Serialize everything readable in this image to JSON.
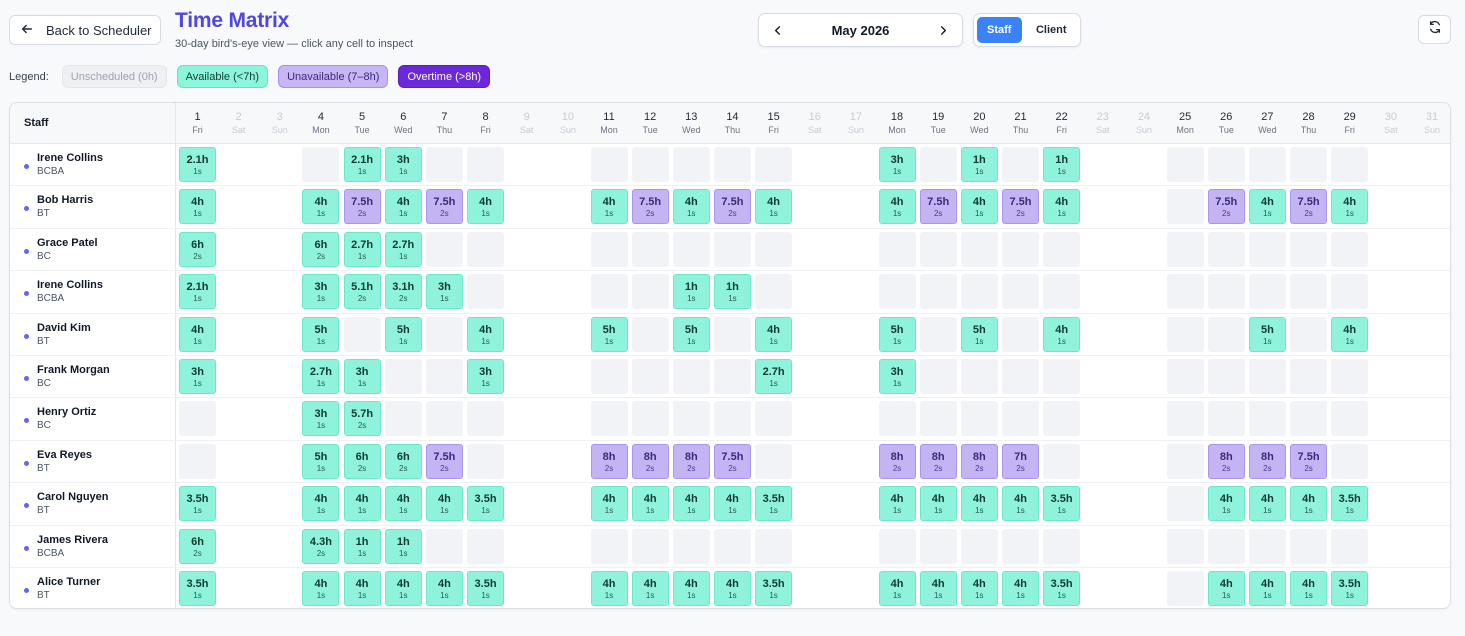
{
  "header": {
    "back_label": "Back to Scheduler",
    "title": "Time Matrix",
    "subtitle": "30-day bird's-eye view — click any cell to inspect",
    "month_label": "May 2026",
    "view_toggle": {
      "staff": "Staff",
      "client": "Client",
      "active": "Staff"
    }
  },
  "legend": {
    "label": "Legend:",
    "items": [
      {
        "key": "unsched",
        "label": "Unscheduled (0h)"
      },
      {
        "key": "avail",
        "label": "Available (<7h)"
      },
      {
        "key": "unavail",
        "label": "Unavailable (7–8h)"
      },
      {
        "key": "over",
        "label": "Overtime (>8h)"
      }
    ]
  },
  "colors": {
    "accent": "#4f46e5",
    "toggle_active": "#3b82f6",
    "available": "#8ef3da",
    "unavailable": "#c4b4f3",
    "overtime": "#6d28d9",
    "unscheduled": "#f1f3f7"
  },
  "table": {
    "staff_header": "Staff",
    "days": [
      {
        "d": "1",
        "w": "Fri"
      },
      {
        "d": "2",
        "w": "Sat",
        "we": true
      },
      {
        "d": "3",
        "w": "Sun",
        "we": true
      },
      {
        "d": "4",
        "w": "Mon"
      },
      {
        "d": "5",
        "w": "Tue"
      },
      {
        "d": "6",
        "w": "Wed"
      },
      {
        "d": "7",
        "w": "Thu"
      },
      {
        "d": "8",
        "w": "Fri"
      },
      {
        "d": "9",
        "w": "Sat",
        "we": true
      },
      {
        "d": "10",
        "w": "Sun",
        "we": true
      },
      {
        "d": "11",
        "w": "Mon"
      },
      {
        "d": "12",
        "w": "Tue"
      },
      {
        "d": "13",
        "w": "Wed"
      },
      {
        "d": "14",
        "w": "Thu"
      },
      {
        "d": "15",
        "w": "Fri"
      },
      {
        "d": "16",
        "w": "Sat",
        "we": true
      },
      {
        "d": "17",
        "w": "Sun",
        "we": true
      },
      {
        "d": "18",
        "w": "Mon"
      },
      {
        "d": "19",
        "w": "Tue"
      },
      {
        "d": "20",
        "w": "Wed"
      },
      {
        "d": "21",
        "w": "Thu"
      },
      {
        "d": "22",
        "w": "Fri"
      },
      {
        "d": "23",
        "w": "Sat",
        "we": true
      },
      {
        "d": "24",
        "w": "Sun",
        "we": true
      },
      {
        "d": "25",
        "w": "Mon"
      },
      {
        "d": "26",
        "w": "Tue"
      },
      {
        "d": "27",
        "w": "Wed"
      },
      {
        "d": "28",
        "w": "Thu"
      },
      {
        "d": "29",
        "w": "Fri"
      },
      {
        "d": "30",
        "w": "Sat",
        "we": true
      },
      {
        "d": "31",
        "w": "Sun",
        "we": true
      }
    ],
    "rows": [
      {
        "name": "Irene Collins",
        "role": "BCBA",
        "cells": [
          [
            "2.1h",
            "1s"
          ],
          null,
          null,
          "e",
          [
            "2.1h",
            "1s"
          ],
          [
            "3h",
            "1s"
          ],
          "e",
          "e",
          null,
          null,
          "e",
          "e",
          "e",
          "e",
          "e",
          null,
          null,
          [
            "3h",
            "1s"
          ],
          "e",
          [
            "1h",
            "1s"
          ],
          "e",
          [
            "1h",
            "1s"
          ],
          null,
          null,
          "e",
          "e",
          "e",
          "e",
          "e",
          null,
          null
        ]
      },
      {
        "name": "Bob Harris",
        "role": "BT",
        "cells": [
          [
            "4h",
            "1s"
          ],
          null,
          null,
          [
            "4h",
            "1s"
          ],
          [
            "7.5h",
            "2s"
          ],
          [
            "4h",
            "1s"
          ],
          [
            "7.5h",
            "2s"
          ],
          [
            "4h",
            "1s"
          ],
          null,
          null,
          [
            "4h",
            "1s"
          ],
          [
            "7.5h",
            "2s"
          ],
          [
            "4h",
            "1s"
          ],
          [
            "7.5h",
            "2s"
          ],
          [
            "4h",
            "1s"
          ],
          null,
          null,
          [
            "4h",
            "1s"
          ],
          [
            "7.5h",
            "2s"
          ],
          [
            "4h",
            "1s"
          ],
          [
            "7.5h",
            "2s"
          ],
          [
            "4h",
            "1s"
          ],
          null,
          null,
          "e",
          [
            "7.5h",
            "2s"
          ],
          [
            "4h",
            "1s"
          ],
          [
            "7.5h",
            "2s"
          ],
          [
            "4h",
            "1s"
          ],
          null,
          null
        ]
      },
      {
        "name": "Grace Patel",
        "role": "BC",
        "cells": [
          [
            "6h",
            "2s"
          ],
          null,
          null,
          [
            "6h",
            "2s"
          ],
          [
            "2.7h",
            "1s"
          ],
          [
            "2.7h",
            "1s"
          ],
          "e",
          "e",
          null,
          null,
          "e",
          "e",
          "e",
          "e",
          "e",
          null,
          null,
          "e",
          "e",
          "e",
          "e",
          "e",
          null,
          null,
          "e",
          "e",
          "e",
          "e",
          "e",
          null,
          null
        ]
      },
      {
        "name": "Irene Collins",
        "role": "BCBA",
        "cells": [
          [
            "2.1h",
            "1s"
          ],
          null,
          null,
          [
            "3h",
            "1s"
          ],
          [
            "5.1h",
            "2s"
          ],
          [
            "3.1h",
            "2s"
          ],
          [
            "3h",
            "1s"
          ],
          "e",
          null,
          null,
          "e",
          "e",
          [
            "1h",
            "1s"
          ],
          [
            "1h",
            "1s"
          ],
          "e",
          null,
          null,
          "e",
          "e",
          "e",
          "e",
          "e",
          null,
          null,
          "e",
          "e",
          "e",
          "e",
          "e",
          null,
          null
        ]
      },
      {
        "name": "David Kim",
        "role": "BT",
        "cells": [
          [
            "4h",
            "1s"
          ],
          null,
          null,
          [
            "5h",
            "1s"
          ],
          "e",
          [
            "5h",
            "1s"
          ],
          "e",
          [
            "4h",
            "1s"
          ],
          null,
          null,
          [
            "5h",
            "1s"
          ],
          "e",
          [
            "5h",
            "1s"
          ],
          "e",
          [
            "4h",
            "1s"
          ],
          null,
          null,
          [
            "5h",
            "1s"
          ],
          "e",
          [
            "5h",
            "1s"
          ],
          "e",
          [
            "4h",
            "1s"
          ],
          null,
          null,
          "e",
          "e",
          [
            "5h",
            "1s"
          ],
          "e",
          [
            "4h",
            "1s"
          ],
          null,
          null
        ]
      },
      {
        "name": "Frank Morgan",
        "role": "BC",
        "cells": [
          [
            "3h",
            "1s"
          ],
          null,
          null,
          [
            "2.7h",
            "1s"
          ],
          [
            "3h",
            "1s"
          ],
          "e",
          "e",
          [
            "3h",
            "1s"
          ],
          null,
          null,
          "e",
          "e",
          "e",
          "e",
          [
            "2.7h",
            "1s"
          ],
          null,
          null,
          [
            "3h",
            "1s"
          ],
          "e",
          "e",
          "e",
          "e",
          null,
          null,
          "e",
          "e",
          "e",
          "e",
          "e",
          null,
          null
        ]
      },
      {
        "name": "Henry Ortiz",
        "role": "BC",
        "cells": [
          "e",
          null,
          null,
          [
            "3h",
            "1s"
          ],
          [
            "5.7h",
            "2s"
          ],
          "e",
          "e",
          "e",
          null,
          null,
          "e",
          "e",
          "e",
          "e",
          "e",
          null,
          null,
          "e",
          "e",
          "e",
          "e",
          "e",
          null,
          null,
          "e",
          "e",
          "e",
          "e",
          "e",
          null,
          null
        ]
      },
      {
        "name": "Eva Reyes",
        "role": "BT",
        "cells": [
          "e",
          null,
          null,
          [
            "5h",
            "1s"
          ],
          [
            "6h",
            "2s"
          ],
          [
            "6h",
            "2s"
          ],
          [
            "7.5h",
            "2s"
          ],
          "e",
          null,
          null,
          [
            "8h",
            "2s"
          ],
          [
            "8h",
            "2s"
          ],
          [
            "8h",
            "2s"
          ],
          [
            "7.5h",
            "2s"
          ],
          "e",
          null,
          null,
          [
            "8h",
            "2s"
          ],
          [
            "8h",
            "2s"
          ],
          [
            "8h",
            "2s"
          ],
          [
            "7h",
            "2s"
          ],
          "e",
          null,
          null,
          "e",
          [
            "8h",
            "2s"
          ],
          [
            "8h",
            "2s"
          ],
          [
            "7.5h",
            "2s"
          ],
          "e",
          null,
          null
        ]
      },
      {
        "name": "Carol Nguyen",
        "role": "BT",
        "cells": [
          [
            "3.5h",
            "1s"
          ],
          null,
          null,
          [
            "4h",
            "1s"
          ],
          [
            "4h",
            "1s"
          ],
          [
            "4h",
            "1s"
          ],
          [
            "4h",
            "1s"
          ],
          [
            "3.5h",
            "1s"
          ],
          null,
          null,
          [
            "4h",
            "1s"
          ],
          [
            "4h",
            "1s"
          ],
          [
            "4h",
            "1s"
          ],
          [
            "4h",
            "1s"
          ],
          [
            "3.5h",
            "1s"
          ],
          null,
          null,
          [
            "4h",
            "1s"
          ],
          [
            "4h",
            "1s"
          ],
          [
            "4h",
            "1s"
          ],
          [
            "4h",
            "1s"
          ],
          [
            "3.5h",
            "1s"
          ],
          null,
          null,
          "e",
          [
            "4h",
            "1s"
          ],
          [
            "4h",
            "1s"
          ],
          [
            "4h",
            "1s"
          ],
          [
            "3.5h",
            "1s"
          ],
          null,
          null
        ]
      },
      {
        "name": "James Rivera",
        "role": "BCBA",
        "cells": [
          [
            "6h",
            "2s"
          ],
          null,
          null,
          [
            "4.3h",
            "2s"
          ],
          [
            "1h",
            "1s"
          ],
          [
            "1h",
            "1s"
          ],
          "e",
          "e",
          null,
          null,
          "e",
          "e",
          "e",
          "e",
          "e",
          null,
          null,
          "e",
          "e",
          "e",
          "e",
          "e",
          null,
          null,
          "e",
          "e",
          "e",
          "e",
          "e",
          null,
          null
        ]
      },
      {
        "name": "Alice Turner",
        "role": "BT",
        "cells": [
          [
            "3.5h",
            "1s"
          ],
          null,
          null,
          [
            "4h",
            "1s"
          ],
          [
            "4h",
            "1s"
          ],
          [
            "4h",
            "1s"
          ],
          [
            "4h",
            "1s"
          ],
          [
            "3.5h",
            "1s"
          ],
          null,
          null,
          [
            "4h",
            "1s"
          ],
          [
            "4h",
            "1s"
          ],
          [
            "4h",
            "1s"
          ],
          [
            "4h",
            "1s"
          ],
          [
            "3.5h",
            "1s"
          ],
          null,
          null,
          [
            "4h",
            "1s"
          ],
          [
            "4h",
            "1s"
          ],
          [
            "4h",
            "1s"
          ],
          [
            "4h",
            "1s"
          ],
          [
            "3.5h",
            "1s"
          ],
          null,
          null,
          "e",
          [
            "4h",
            "1s"
          ],
          [
            "4h",
            "1s"
          ],
          [
            "4h",
            "1s"
          ],
          [
            "3.5h",
            "1s"
          ],
          null,
          null
        ]
      }
    ]
  }
}
